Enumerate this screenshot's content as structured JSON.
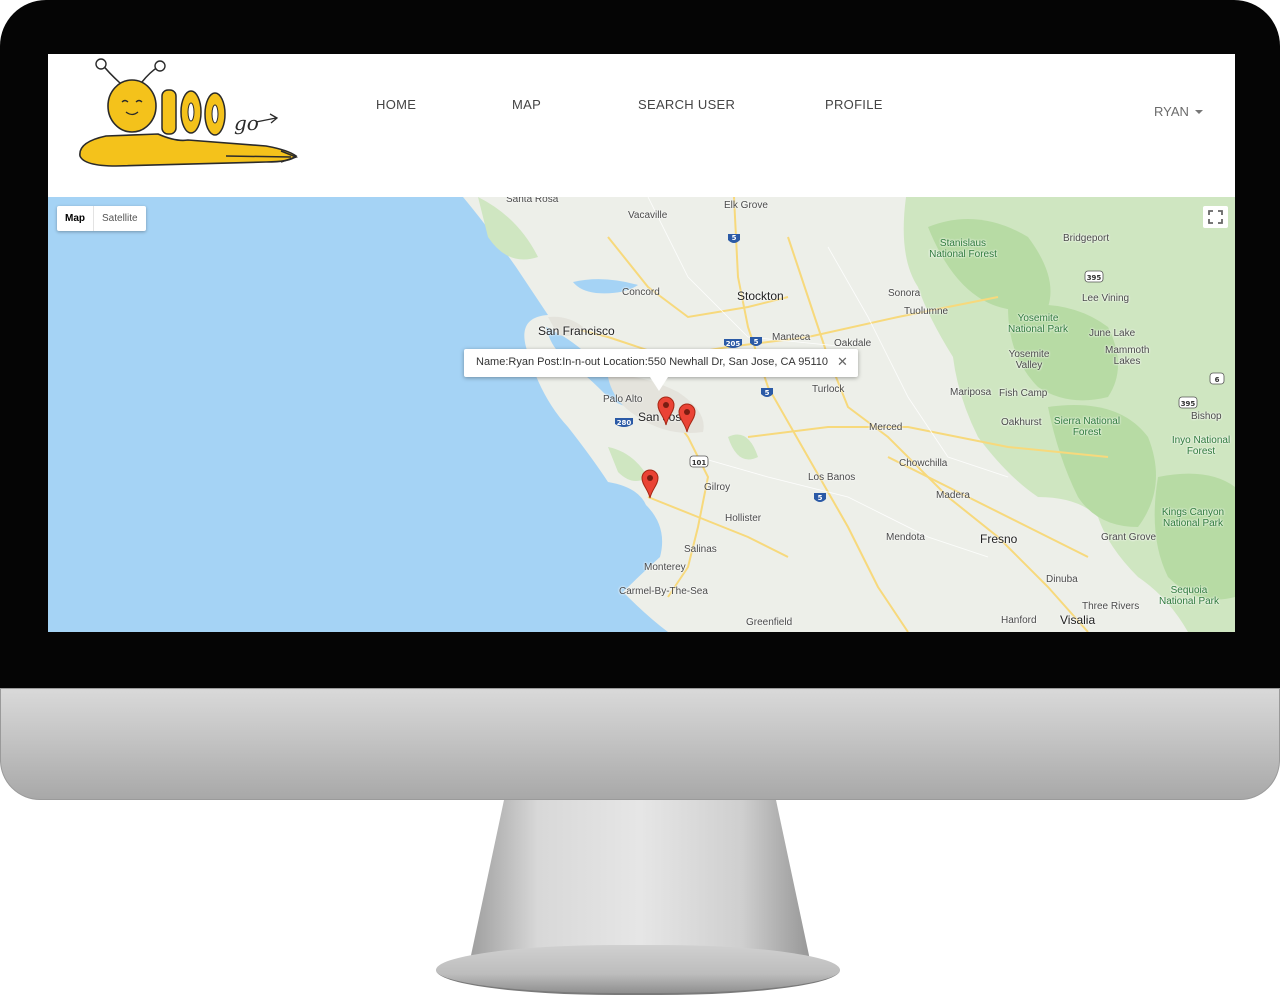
{
  "nav": {
    "home": "HOME",
    "map": "MAP",
    "search_user": "SEARCH USER",
    "profile": "PROFILE",
    "user": "RYAN"
  },
  "logo_text": "FOO go",
  "map": {
    "type_map": "Map",
    "type_satellite": "Satellite",
    "info": "Name:Ryan Post:In-n-out Location:550 Newhall Dr, San Jose, CA 95110",
    "close_symbol": "✕",
    "places": {
      "santa_rosa": "Santa Rosa",
      "vacaville": "Vacaville",
      "elk_grove": "Elk Grove",
      "concord": "Concord",
      "stockton": "Stockton",
      "san_francisco": "San Francisco",
      "manteca": "Manteca",
      "oakdale": "Oakdale",
      "palo_alto": "Palo Alto",
      "san_jose": "San Jose",
      "turlock": "Turlock",
      "merced": "Merced",
      "chowchilla": "Chowchilla",
      "los_banos": "Los Banos",
      "gilroy": "Gilroy",
      "hollister": "Hollister",
      "madera": "Madera",
      "mendota": "Mendota",
      "fresno": "Fresno",
      "salinas": "Salinas",
      "monterey": "Monterey",
      "carmel": "Carmel-By-The-Sea",
      "greenfield": "Greenfield",
      "dinuba": "Dinuba",
      "hanford": "Hanford",
      "visalia": "Visalia",
      "three_rivers": "Three Rivers",
      "sonora": "Sonora",
      "tuolumne": "Tuolumne",
      "bridgeport": "Bridgeport",
      "lee_vining": "Lee Vining",
      "june_lake": "June Lake",
      "mammoth_lakes": "Mammoth Lakes",
      "yosemite_valley": "Yosemite Valley",
      "mariposa": "Mariposa",
      "fish_camp": "Fish Camp",
      "oakhurst": "Oakhurst",
      "bishop": "Bishop",
      "grant_grove": "Grant Grove",
      "stanislaus_nf": "Stanislaus National Forest",
      "yosemite_np": "Yosemite National Park",
      "sierra_nf": "Sierra National Forest",
      "inyo_nf": "Inyo National Forest",
      "kings_canyon_np": "Kings Canyon National Park",
      "sequoia_np": "Sequoia National Park"
    },
    "shields": {
      "i5": "5",
      "i205": "205",
      "i280": "280",
      "us101": "101",
      "us395": "395",
      "us6": "6"
    }
  }
}
